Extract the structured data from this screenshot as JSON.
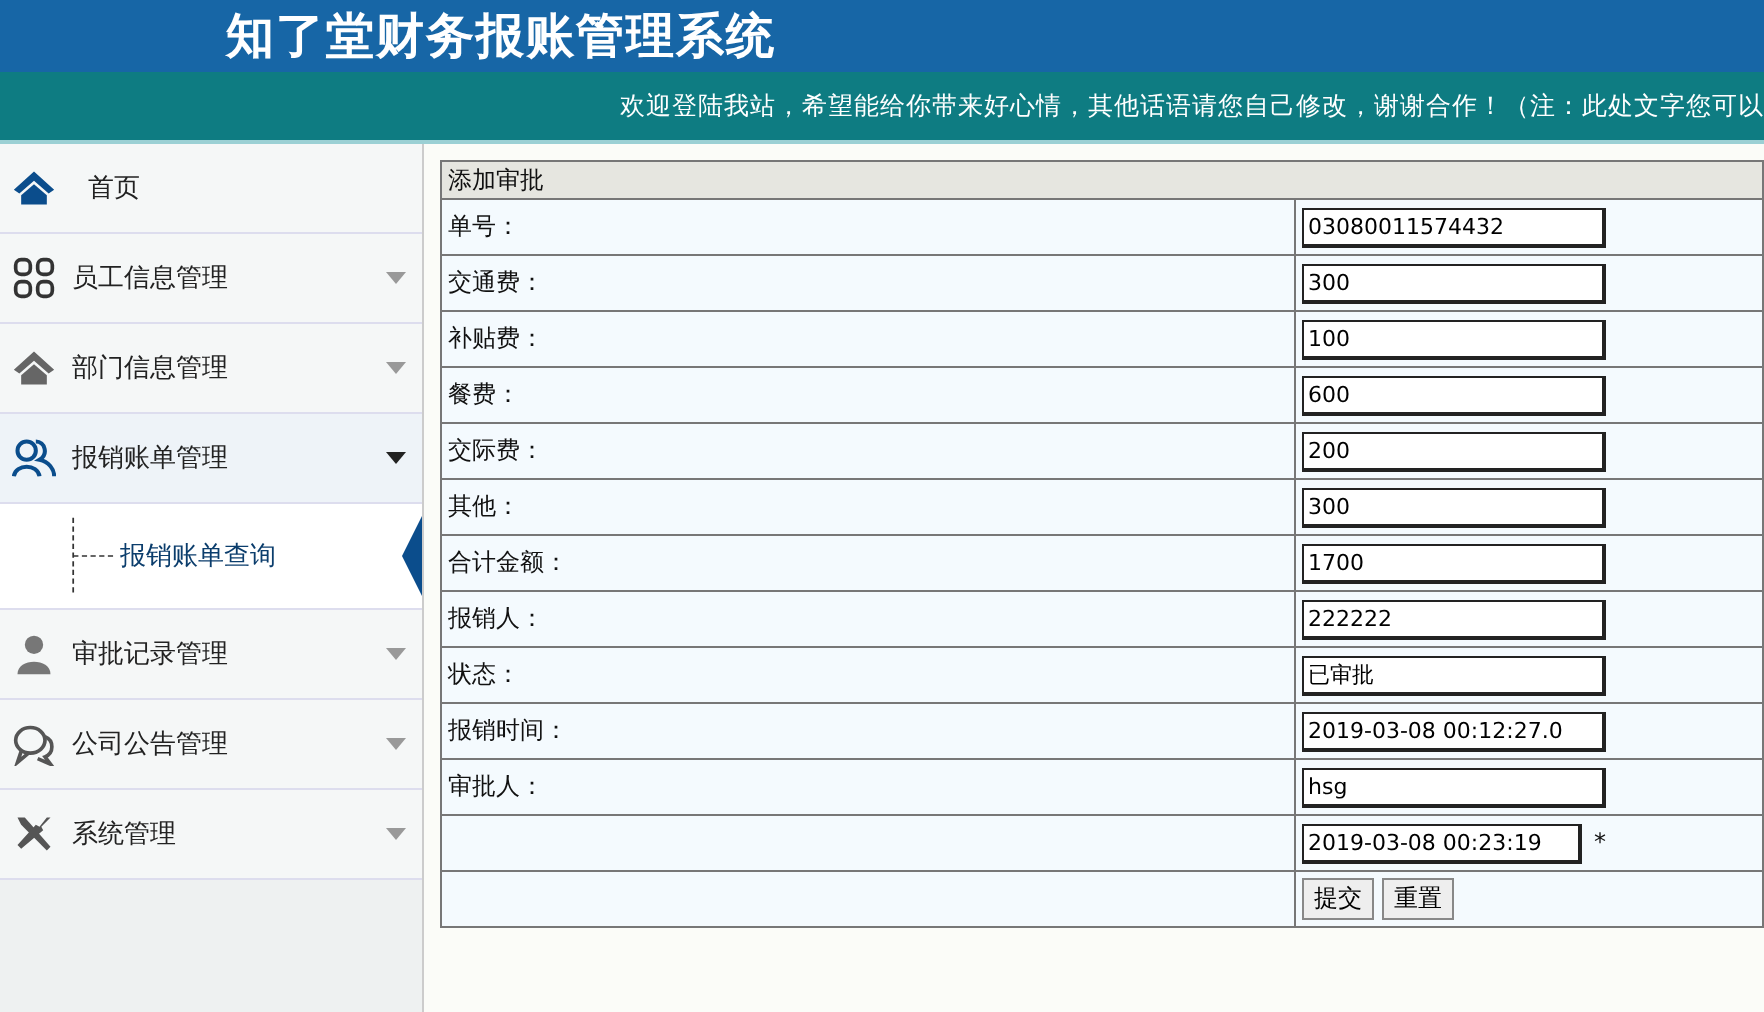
{
  "header": {
    "title": "知了堂财务报账管理系统",
    "welcome": "欢迎登陆我站，希望能给你带来好心情，其他话语请您自己修改，谢谢合作！（注：此处文字您可以"
  },
  "sidebar": {
    "items": [
      {
        "kind": "home",
        "label": "首页"
      },
      {
        "kind": "grid",
        "label": "员工信息管理",
        "expanded": false
      },
      {
        "kind": "house",
        "label": "部门信息管理",
        "expanded": false
      },
      {
        "kind": "users",
        "label": "报销账单管理",
        "expanded": true,
        "children": [
          {
            "label": "报销账单查询",
            "selected": true
          }
        ]
      },
      {
        "kind": "person",
        "label": "审批记录管理",
        "expanded": false
      },
      {
        "kind": "chat",
        "label": "公司公告管理",
        "expanded": false
      },
      {
        "kind": "tools",
        "label": "系统管理",
        "expanded": false
      }
    ]
  },
  "form": {
    "title": "添加审批",
    "rows": [
      {
        "label": "单号：",
        "value": "03080011574432"
      },
      {
        "label": "交通费：",
        "value": "300"
      },
      {
        "label": "补贴费：",
        "value": "100"
      },
      {
        "label": "餐费：",
        "value": "600"
      },
      {
        "label": "交际费：",
        "value": "200"
      },
      {
        "label": "其他：",
        "value": "300"
      },
      {
        "label": "合计金额：",
        "value": "1700"
      },
      {
        "label": "报销人：",
        "value": "222222"
      },
      {
        "label": "状态：",
        "value": "已审批"
      },
      {
        "label": "报销时间：",
        "value": "2019-03-08 00:12:27.0"
      },
      {
        "label": "审批人：",
        "value": "hsg"
      },
      {
        "value": "2019-03-08 00:23:19",
        "required_mark": "*"
      }
    ],
    "buttons": [
      "提交",
      "重置"
    ]
  }
}
